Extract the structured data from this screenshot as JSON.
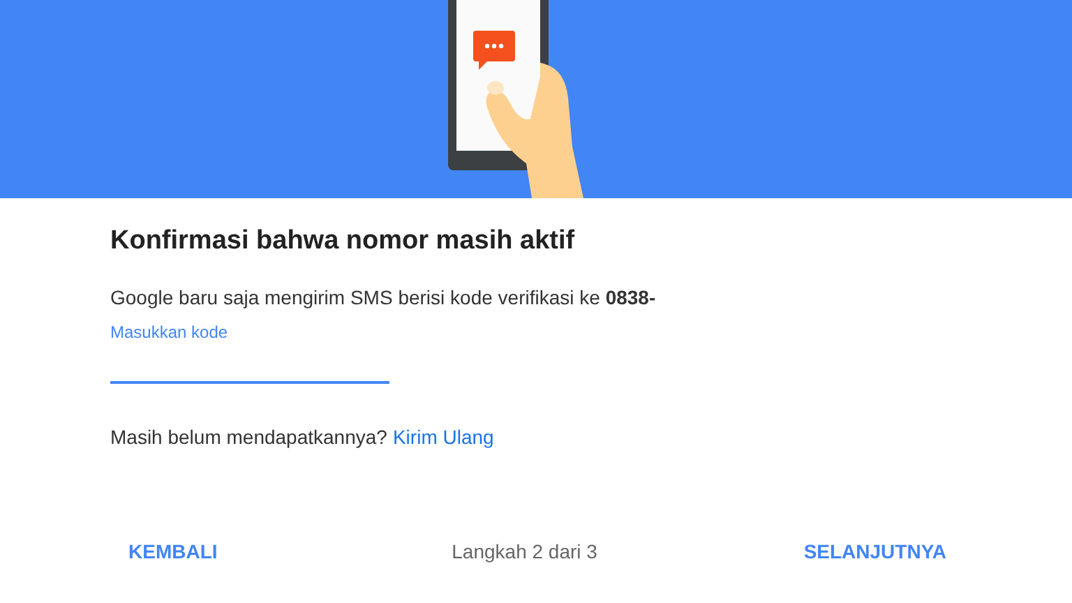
{
  "title": "Konfirmasi bahwa nomor masih aktif",
  "message": "Google baru saja mengirim SMS berisi kode verifikasi ke **0838-**",
  "code_field": {
    "label": "Masukkan kode"
  },
  "resend": {
    "text": "Masih belum mendapatkannya?",
    "link": "Kirim Ulang"
  },
  "footer": {
    "back": "KEMBALI",
    "step": "Langkah 2 dari 3",
    "next": "SELANJUTNYA"
  }
}
